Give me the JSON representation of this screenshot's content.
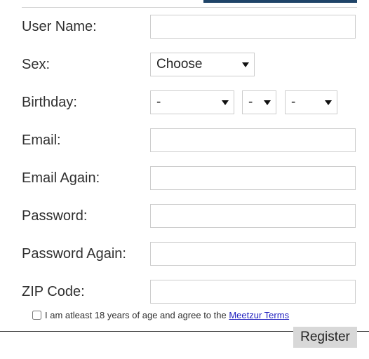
{
  "theme": {
    "accent_bar_color": "#1f4468",
    "divider_color": "#cfcfcf",
    "input_border_color": "#cccccc",
    "link_color": "#2020c0",
    "button_bg_color": "#d8d8d8",
    "footer_rule_color": "#1a1a1a",
    "text_color": "#303030"
  },
  "form": {
    "rows": [
      {
        "label": "User Name:",
        "control": "text",
        "value": "",
        "placeholder": ""
      },
      {
        "label": "Sex:",
        "control": "select",
        "value": "Choose"
      },
      {
        "label": "Birthday:",
        "control": "date-selects"
      },
      {
        "label": "Email:",
        "control": "text",
        "value": "",
        "placeholder": ""
      },
      {
        "label": "Email Again:",
        "control": "text",
        "value": "",
        "placeholder": ""
      },
      {
        "label": "Password:",
        "control": "text",
        "value": "",
        "placeholder": ""
      },
      {
        "label": "Password Again:",
        "control": "text",
        "value": "",
        "placeholder": ""
      },
      {
        "label": "ZIP Code:",
        "control": "text",
        "value": "",
        "placeholder": ""
      }
    ],
    "birthday": {
      "month_value": "-",
      "day_value": "-",
      "year_value": "-"
    }
  },
  "terms": {
    "checked": false,
    "text_before_link": "I am atleast 18 years of age and agree to the ",
    "link_label": "Meetzur Terms"
  },
  "footer": {
    "register_label": "Register"
  }
}
